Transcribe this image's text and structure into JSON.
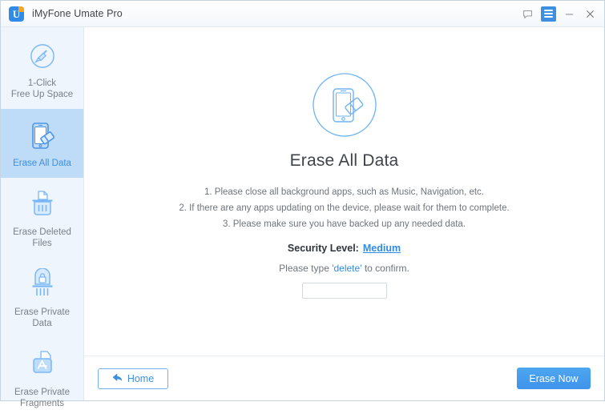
{
  "window": {
    "app_title": "iMyFone Umate Pro",
    "logo_letter": "U",
    "controls": [
      {
        "name": "feedback-icon",
        "label": ""
      },
      {
        "name": "menu-icon",
        "label": ""
      },
      {
        "name": "minimize-icon",
        "label": ""
      },
      {
        "name": "close-icon",
        "label": ""
      }
    ]
  },
  "sidebar": {
    "items": [
      {
        "label": "1-Click\nFree Up Space",
        "line1": "1-Click",
        "line2": "Free Up Space",
        "icon": "broom-circle-icon",
        "selected": false
      },
      {
        "label": "Erase All Data",
        "line1": "Erase All Data",
        "line2": "",
        "icon": "phone-eraser-icon",
        "selected": true
      },
      {
        "label": "Erase Deleted Files",
        "line1": "Erase Deleted Files",
        "line2": "",
        "icon": "shredder-document-icon",
        "selected": false
      },
      {
        "label": "Erase Private Data",
        "line1": "Erase Private Data",
        "line2": "",
        "icon": "shredder-lock-icon",
        "selected": false
      },
      {
        "label": "Erase Private\nFragments",
        "line1": "Erase Private",
        "line2": "Fragments",
        "icon": "app-folder-icon",
        "selected": false
      }
    ]
  },
  "content": {
    "hero_icon": "phone-eraser-circle-icon",
    "title": "Erase All Data",
    "steps": [
      "1. Please close all background apps, such as Music, Navigation, etc.",
      "2. If there are any apps updating on the device, please wait for them to complete.",
      "3. Please make sure you have backed up any needed data."
    ],
    "security_label": "Security Level:",
    "security_value": "Medium",
    "confirm_prefix": "Please type ",
    "confirm_word": "'delete'",
    "confirm_suffix": " to confirm.",
    "confirm_input_value": "",
    "confirm_input_placeholder": ""
  },
  "footer": {
    "home_label": "Home",
    "erase_label": "Erase Now"
  },
  "colors": {
    "accent": "#3d8fe0",
    "link": "#2f8ae8",
    "sidebar_bg": "#eef5fd",
    "selected_bg": "#bedbf7",
    "icon_blue": "#6fb3f2",
    "text_gray": "#6f757c"
  }
}
